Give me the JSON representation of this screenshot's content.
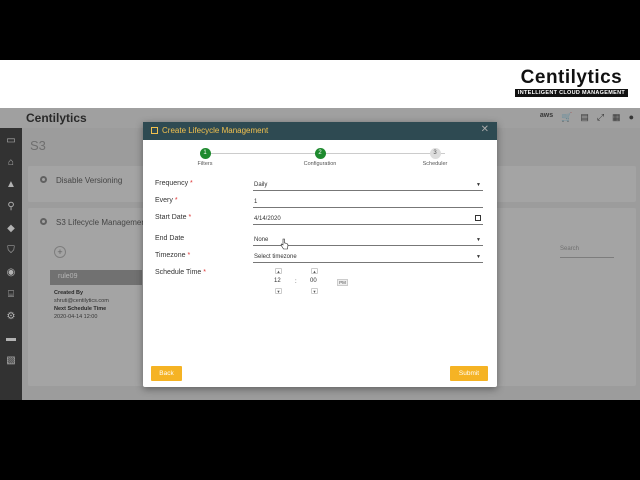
{
  "brand": {
    "name": "Centilytics",
    "tagline": "INTELLIGENT CLOUD MANAGEMENT"
  },
  "app": {
    "logo": "Centilytics",
    "cloud_label": "aws",
    "page_title": "S3"
  },
  "cards": {
    "disable_versioning": "Disable Versioning",
    "lifecycle": "S3 Lifecycle Managemen",
    "search_label": "Search",
    "rule": {
      "name": "rule09",
      "created_by_label": "Created By",
      "created_by": "shruti@centilytics.com",
      "next_schedule_label": "Next Schedule Time",
      "next_schedule": "2020-04-14 12:00"
    }
  },
  "modal": {
    "title": "Create Lifecycle Management",
    "steps": [
      {
        "num": "1",
        "label": "Filters",
        "status": "done"
      },
      {
        "num": "2",
        "label": "Configuration",
        "status": "done"
      },
      {
        "num": "3",
        "label": "Scheduler",
        "status": "pending"
      }
    ],
    "fields": {
      "frequency": {
        "label": "Frequency",
        "value": "Daily"
      },
      "every": {
        "label": "Every",
        "value": "1"
      },
      "start_date": {
        "label": "Start Date",
        "value": "4/14/2020"
      },
      "end_date": {
        "label": "End Date",
        "value": "None"
      },
      "timezone": {
        "label": "Timezone",
        "value": "Select timezone"
      },
      "schedule_time": {
        "label": "Schedule Time",
        "hour": "12",
        "minute": "00",
        "separator": ":",
        "meridian": "PM"
      }
    },
    "back_label": "Back",
    "submit_label": "Submit"
  },
  "colors": {
    "header_bg": "#2e4a52",
    "header_text": "#f2c14e",
    "accent": "#f5b324",
    "step_done": "#1e8a2e"
  }
}
